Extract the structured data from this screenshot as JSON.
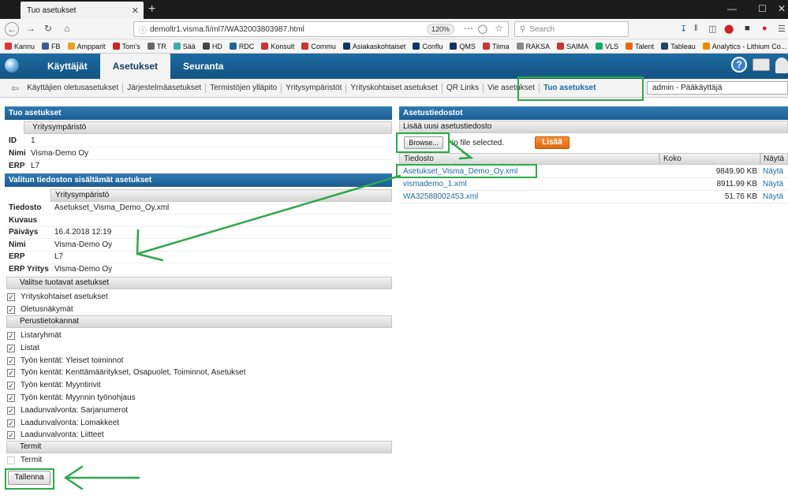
{
  "browser": {
    "tab_title": "Tuo asetukset",
    "tab_close": "✕",
    "new_tab": "+",
    "url": "demoltr1.visma.fi/ml7/WA32003803987.html",
    "zoom": "120%",
    "search_placeholder": "Search",
    "bookmarks": [
      {
        "label": "Kannu",
        "color": "#d33"
      },
      {
        "label": "FB",
        "color": "#3b5998"
      },
      {
        "label": "Ampparit",
        "color": "#f0a020"
      },
      {
        "label": "Tom's",
        "color": "#c22"
      },
      {
        "label": "TR",
        "color": "#666"
      },
      {
        "label": "Sää",
        "color": "#4aa"
      },
      {
        "label": "HD",
        "color": "#444"
      },
      {
        "label": "RDC",
        "color": "#269"
      },
      {
        "label": "Konsult",
        "color": "#c33"
      },
      {
        "label": "Commu",
        "color": "#c33"
      },
      {
        "label": "Asiakaskohtaiset",
        "color": "#136"
      },
      {
        "label": "Conflu",
        "color": "#136"
      },
      {
        "label": "QMS",
        "color": "#136"
      },
      {
        "label": "Tiima",
        "color": "#c33"
      },
      {
        "label": "RAKSA",
        "color": "#888"
      },
      {
        "label": "SAIMA",
        "color": "#c33"
      },
      {
        "label": "VLS",
        "color": "#1a6"
      },
      {
        "label": "Talent",
        "color": "#e60"
      },
      {
        "label": "Tableau",
        "color": "#246"
      },
      {
        "label": "Analytics - Lithium Co...",
        "color": "#e80"
      }
    ]
  },
  "app": {
    "main_tabs": [
      "Käyttäjät",
      "Asetukset",
      "Seuranta"
    ],
    "help_label": "?",
    "sub_tabs": [
      "Käyttäjien oletusasetukset",
      "Järjestelmäasetukset",
      "Termistöjen ylläpito",
      "Yritysympäristöt",
      "Yrityskohtaiset asetukset",
      "QR Links",
      "Vie asetukset",
      "Tuo asetukset"
    ],
    "user_select": "admin - Pääkäyttäjä"
  },
  "left": {
    "title": "Tuo asetukset",
    "env_header": "Yritysympäristö",
    "env_rows": [
      {
        "label": "ID",
        "value": "1"
      },
      {
        "label": "Nimi",
        "value": "Visma-Demo Oy"
      },
      {
        "label": "ERP",
        "value": "L7"
      }
    ],
    "file_section_title": "Valitun tiedoston sisältämät asetukset",
    "file_env_header": "Yritysympäristö",
    "file_rows": [
      {
        "label": "Tiedosto",
        "value": "Asetukset_Visma_Demo_Oy.xml"
      },
      {
        "label": "Kuvaus",
        "value": ""
      },
      {
        "label": "Päiväys",
        "value": "16.4.2018 12:19"
      },
      {
        "label": "Nimi",
        "value": "Visma-Demo Oy"
      },
      {
        "label": "ERP",
        "value": "L7"
      },
      {
        "label": "ERP Yritys",
        "value": "Visma-Demo Oy"
      }
    ],
    "select_header": "Valitse tuotavat asetukset",
    "select_items": [
      "Yrityskohtaiset asetukset",
      "Oletusnäkymät"
    ],
    "base_header": "Perustietokannat",
    "base_items": [
      "Listaryhmät",
      "Listat",
      "Työn kentät: Yleiset toiminnot",
      "Työn kentät: Kenttämääritykset, Osapuolet, Toiminnot, Asetukset",
      "Työn kentät: Myyntirivit",
      "Työn kentät: Myynnin työnohjaus",
      "Laadunvalvonta: Sarjanumerot",
      "Laadunvalvonta: Lomakkeet",
      "Laadunvalvonta: Liitteet"
    ],
    "terms_header": "Termit",
    "terms_items": [
      "Termit"
    ],
    "save_button": "Tallenna"
  },
  "right": {
    "title": "Asetustiedostot",
    "add_header": "Lisää uusi asetustiedosto",
    "browse_button": "Browse...",
    "no_file": "No file selected.",
    "add_button": "Lisää",
    "columns": [
      "Tiedosto",
      "Koko",
      "Näytä"
    ],
    "files": [
      {
        "name": "Asetukset_Visma_Demo_Oy.xml",
        "size": "9849.90 KB",
        "action": "Näytä"
      },
      {
        "name": "vismademo_1.xml",
        "size": "8911.99 KB",
        "action": "Näytä"
      },
      {
        "name": "WA32588002453.xml",
        "size": "51.76 KB",
        "action": "Näytä"
      }
    ]
  },
  "annotation_color": "#2ea84a"
}
